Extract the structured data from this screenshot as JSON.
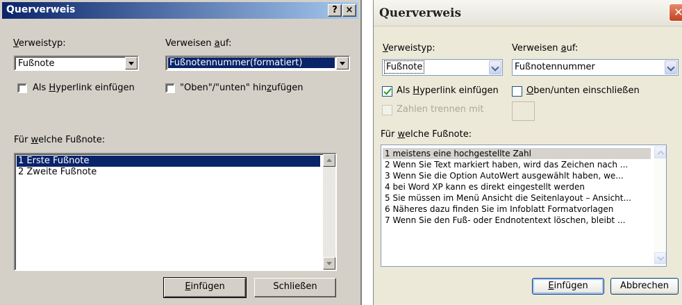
{
  "left_dialog": {
    "title": "Querverweis",
    "help_label": "?",
    "close_label": "×",
    "type_label": {
      "acc": "V",
      "rest": "erweistyp:"
    },
    "type_value": "Fußnote",
    "ref_label": {
      "pre": "Verweisen ",
      "acc": "a",
      "post": "uf:"
    },
    "ref_value": "Fußnotennummer(formatiert)",
    "hyperlink_label": {
      "pre": "Als ",
      "acc": "H",
      "post": "yperlink einfügen"
    },
    "hyperlink_checked": false,
    "above_below_label": {
      "pre": "\"Oben\"/\"unten\" hin",
      "acc": "z",
      "post": "ufügen"
    },
    "above_below_checked": false,
    "list_label": {
      "pre": "Für ",
      "acc": "w",
      "post": "elche Fußnote:"
    },
    "footnotes": [
      "1  Erste Fußnote",
      "2  Zweite Fußnote"
    ],
    "selected_index": 0,
    "insert_button": {
      "acc": "E",
      "rest": "infügen"
    },
    "close_button": "Schließen"
  },
  "right_dialog": {
    "title": "Querverweis",
    "close_label": "✕",
    "type_label": {
      "acc": "V",
      "rest": "erweistyp:"
    },
    "type_value": "Fußnote",
    "ref_label": {
      "pre": "Verweisen ",
      "acc": "a",
      "post": "uf:"
    },
    "ref_value": "Fußnotennummer",
    "hyperlink_label": {
      "pre": "Als ",
      "acc": "H",
      "post": "yperlink einfügen"
    },
    "hyperlink_checked": true,
    "above_below_label": {
      "acc": "O",
      "rest": "ben/unten einschließen"
    },
    "above_below_checked": false,
    "separate_label": "Zahlen trennen mit",
    "separate_enabled": false,
    "list_label": {
      "pre": "Für ",
      "acc": "w",
      "post": "elche Fußnote:"
    },
    "footnotes": [
      "1  meistens eine hochgestellte Zahl",
      "2  Wenn Sie Text markiert haben, wird das Zeichen nach ...",
      "3  Wenn Sie die Option AutoWert ausgewählt haben, we...",
      "4  bei Word XP kann es direkt eingestellt werden",
      "5  Sie müssen im Menü Ansicht die Seitenlayout – Ansicht...",
      "6  Näheres dazu finden Sie im Infoblatt Formatvorlagen",
      "7  Wenn Sie den Fuß- oder Endnotentext löschen, bleibt ..."
    ],
    "selected_index": 0,
    "insert_button": {
      "acc": "E",
      "rest": "infügen"
    },
    "cancel_button": "Abbrechen"
  },
  "colors": {
    "classic_face": "#d4d0c8",
    "classic_title_start": "#0a246a",
    "classic_title_end": "#a6caf0",
    "classic_selection": "#0a246a",
    "xp_face": "#ece9d8",
    "xp_input_border": "#7f9db9",
    "xp_check_mark": "#21a121",
    "xp_close_red": "#c2431e"
  }
}
